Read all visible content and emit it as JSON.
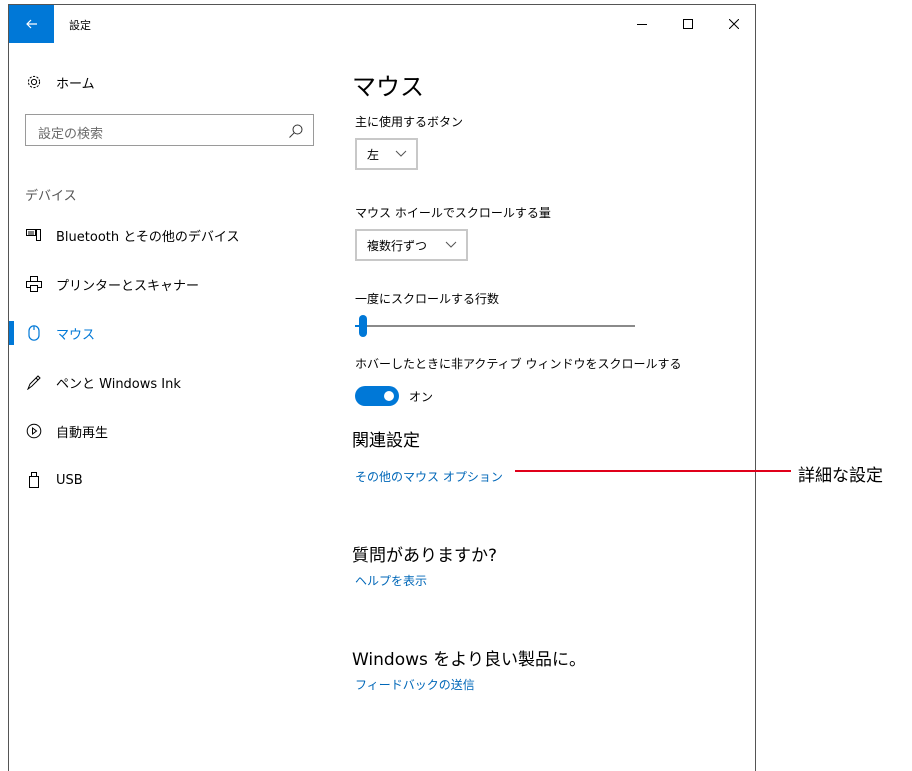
{
  "window": {
    "title": "設定"
  },
  "sidebar": {
    "home_label": "ホーム",
    "search_placeholder": "設定の検索",
    "section": "デバイス",
    "items": [
      {
        "label": "Bluetooth とその他のデバイス",
        "icon": "bluetooth-devices-icon"
      },
      {
        "label": "プリンターとスキャナー",
        "icon": "printer-icon"
      },
      {
        "label": "マウス",
        "icon": "mouse-icon",
        "active": true
      },
      {
        "label": "ペンと Windows Ink",
        "icon": "pen-icon"
      },
      {
        "label": "自動再生",
        "icon": "autoplay-icon"
      },
      {
        "label": "USB",
        "icon": "usb-icon"
      }
    ]
  },
  "main": {
    "title": "マウス",
    "primary_button": {
      "label": "主に使用するボタン",
      "value": "左"
    },
    "wheel_scroll": {
      "label": "マウス ホイールでスクロールする量",
      "value": "複数行ずつ"
    },
    "lines_to_scroll": {
      "label": "一度にスクロールする行数",
      "value_fraction": 0.03
    },
    "inactive_scroll": {
      "label": "ホバーしたときに非アクティブ ウィンドウをスクロールする",
      "state": "オン",
      "on": true
    },
    "related_heading": "関連設定",
    "related_link": "その他のマウス オプション",
    "question_heading": "質問がありますか?",
    "help_link": "ヘルプを表示",
    "improve_heading": "Windows をより良い製品に。",
    "feedback_link": "フィードバックの送信"
  },
  "annotation": {
    "label": "詳細な設定"
  },
  "colors": {
    "accent": "#0078d7",
    "link": "#0067b8",
    "callout": "#e0001a"
  }
}
